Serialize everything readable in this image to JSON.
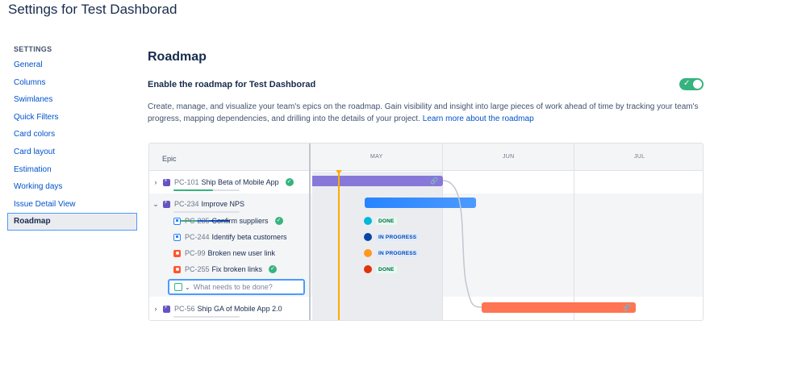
{
  "page": {
    "title": "Settings for Test Dashborad"
  },
  "sidebar": {
    "heading": "SETTINGS",
    "items": [
      {
        "label": "General"
      },
      {
        "label": "Columns"
      },
      {
        "label": "Swimlanes"
      },
      {
        "label": "Quick Filters"
      },
      {
        "label": "Card colors"
      },
      {
        "label": "Card layout"
      },
      {
        "label": "Estimation"
      },
      {
        "label": "Working days"
      },
      {
        "label": "Issue Detail View"
      },
      {
        "label": "Roadmap",
        "active": true
      }
    ]
  },
  "main": {
    "section_title": "Roadmap",
    "enable_label": "Enable the roadmap for Test Dashborad",
    "toggle_on": true,
    "description": "Create, manage, and visualize your team's epics on the roadmap. Gain visibility and insight into large pieces of work ahead of time by tracking your team's progress, mapping dependencies, and drilling into the details of your project.",
    "learn_more": "Learn more about the roadmap"
  },
  "roadmap": {
    "column_header": "Epic",
    "months": [
      "MAY",
      "JUN",
      "JUL"
    ],
    "rows": [
      {
        "key": "PC-101",
        "name": "Ship Beta of Mobile App",
        "type": "epic",
        "done": true,
        "progress": 0.6
      },
      {
        "key": "PC-234",
        "name": "Improve NPS",
        "type": "epic",
        "done": false,
        "progress": 0.6
      },
      {
        "key": "PC-235",
        "name": "Confirm suppliers",
        "type": "task",
        "done": true,
        "status": "DONE"
      },
      {
        "key": "PC-244",
        "name": "Identify beta customers",
        "type": "task",
        "done": false,
        "status": "IN PROGRESS"
      },
      {
        "key": "PC-99",
        "name": "Broken new user link",
        "type": "bug",
        "done": false,
        "status": "IN PROGRESS"
      },
      {
        "key": "PC-255",
        "name": "Fix broken links",
        "type": "bug",
        "done": true,
        "status": "DONE"
      },
      {
        "key": "PC-56",
        "name": "Ship GA of Mobile App 2.0",
        "type": "epic",
        "done": false,
        "progress": 0.0
      }
    ],
    "new_issue_placeholder": "What needs to be done?",
    "colors": {
      "epic": "#6554c0",
      "bar_purple": "#8777d9",
      "bar_blue": "#2684ff",
      "bar_red": "#ff7452",
      "done": "#36b37e",
      "today": "#ffab00"
    }
  }
}
